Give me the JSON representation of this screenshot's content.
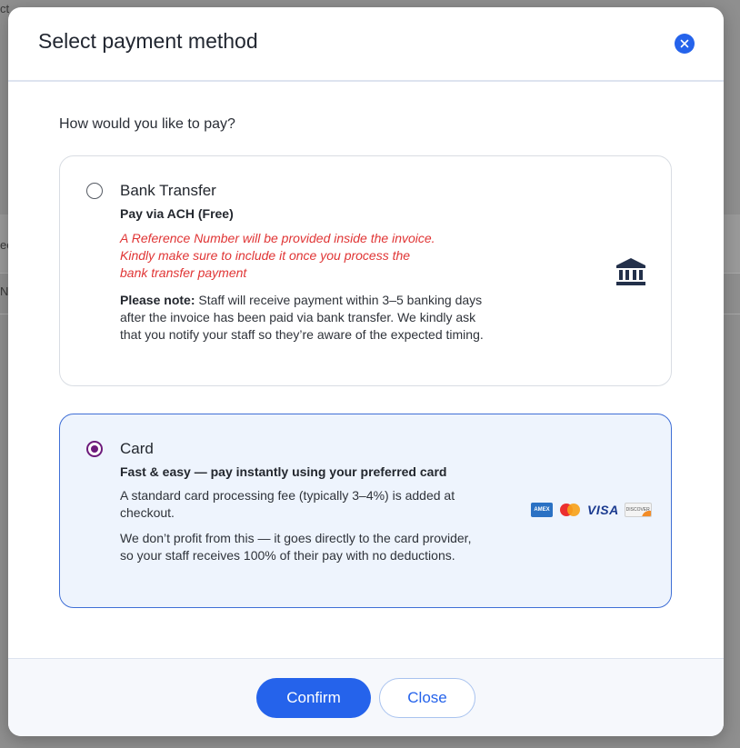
{
  "background": {
    "frag1": "ct",
    "frag2": "ec",
    "frag3": "N"
  },
  "modal": {
    "title": "Select payment method",
    "close_icon": "close-icon",
    "prompt": "How would you like to pay?"
  },
  "options": {
    "bank": {
      "title": "Bank Transfer",
      "subtitle": "Pay via ACH (Free)",
      "warning": "A Reference Number will be provided inside the invoice. Kindly make sure to include it once you process the bank transfer payment",
      "note_label": "Please note:",
      "note_text": " Staff will receive payment within 3–5 banking days after the invoice has been paid via bank transfer. We kindly ask that you notify your staff so they’re aware of the expected timing.",
      "icon": "bank-icon",
      "selected": false
    },
    "card": {
      "title": "Card",
      "subtitle": "Fast & easy — pay instantly using your preferred card",
      "text1": "A standard card processing fee (typically 3–4%) is added at checkout.",
      "text2": "We don’t profit from this — it goes directly to the card provider, so your staff receives 100% of their pay with no deductions.",
      "logos": {
        "amex": "AMEX",
        "visa": "VISA",
        "discover": "DISCOVER"
      },
      "selected": true
    }
  },
  "footer": {
    "confirm_label": "Confirm",
    "close_label": "Close"
  },
  "colors": {
    "primary": "#2563eb",
    "radio_selected": "#6d1b7b",
    "warning": "#e03535",
    "selected_bg": "#eef4fd"
  }
}
